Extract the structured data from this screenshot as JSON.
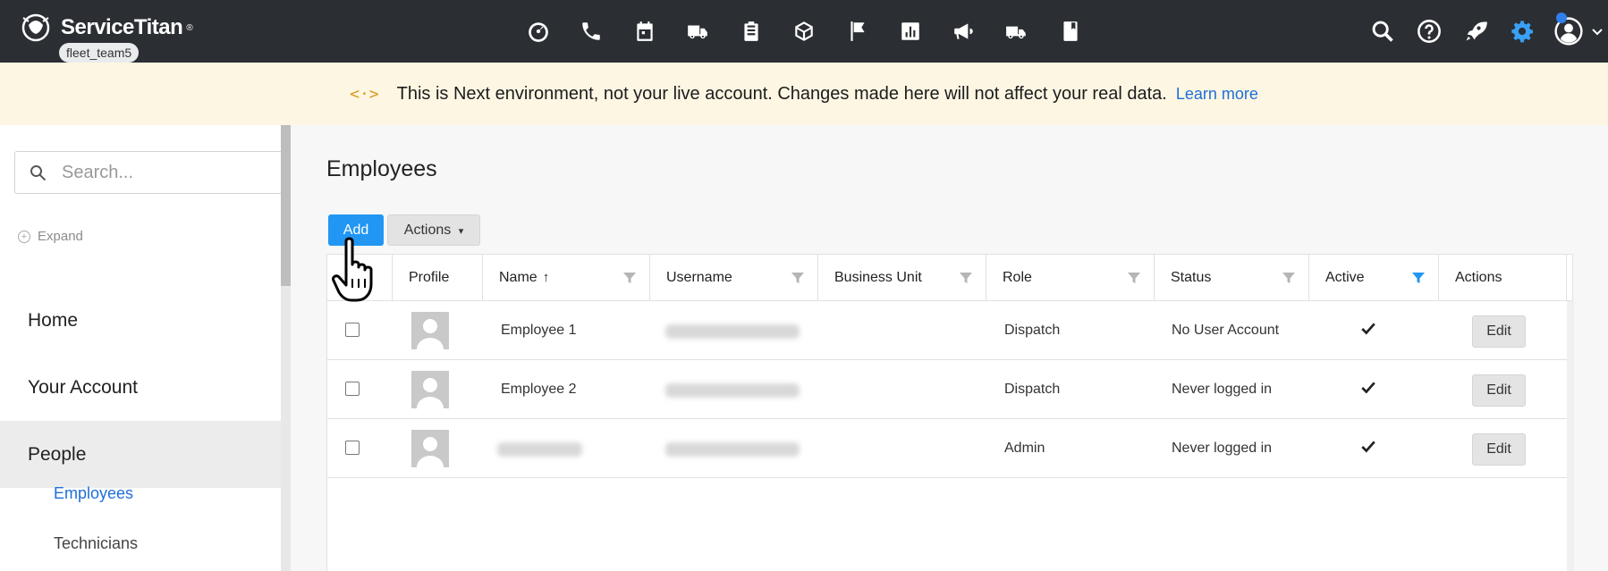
{
  "app": {
    "brand": "ServiceTitan",
    "brand_mark": "®",
    "tenant": "fleet_team5",
    "nav_icons": [
      "dashboard-icon",
      "phone-icon",
      "calendar-icon",
      "truck-icon",
      "clipboard-icon",
      "box-icon",
      "flag-icon",
      "chart-icon",
      "megaphone-icon",
      "fleet-truck-icon",
      "book-icon"
    ],
    "right_icons": [
      "search-icon",
      "help-icon",
      "rocket-icon",
      "gear-icon",
      "user-avatar-icon"
    ],
    "colors": {
      "topbar": "#2b2e33",
      "accent": "#2196f3",
      "gear": "#3aa0f5",
      "banner": "#fdf6e3"
    }
  },
  "banner": {
    "code_glyph": "<·>",
    "message": "This is Next environment, not your live account. Changes made here will not affect your real data.",
    "link": "Learn more"
  },
  "sidebar": {
    "search_placeholder": "Search...",
    "expand_label": "Expand",
    "items": [
      {
        "label": "Home"
      },
      {
        "label": "Your Account"
      },
      {
        "label": "People",
        "active": true
      }
    ],
    "subitems": [
      {
        "label": "Employees",
        "active": true
      },
      {
        "label": "Technicians"
      }
    ]
  },
  "main": {
    "title": "Employees",
    "add_label": "Add",
    "actions_label": "Actions",
    "actions_caret": "▾"
  },
  "table": {
    "columns": [
      "",
      "Profile",
      "Name",
      "Username",
      "Business Unit",
      "Role",
      "Status",
      "Active",
      "Actions"
    ],
    "sort_arrow": "↑",
    "rows": [
      {
        "name": "Employee 1",
        "role": "Dispatch",
        "status": "No User Account",
        "active": true,
        "action": "Edit"
      },
      {
        "name": "Employee 2",
        "role": "Dispatch",
        "status": "Never logged in",
        "active": true,
        "action": "Edit"
      },
      {
        "name": "",
        "role": "Admin",
        "status": "Never logged in",
        "active": true,
        "action": "Edit"
      }
    ]
  }
}
